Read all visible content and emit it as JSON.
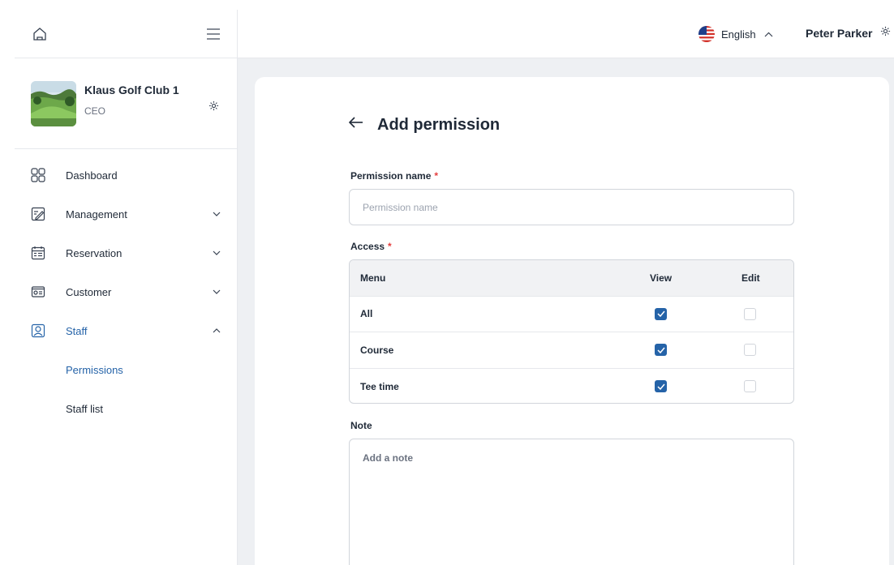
{
  "sidebar": {
    "club": {
      "name": "Klaus Golf Club 1",
      "role": "CEO"
    },
    "items": [
      {
        "label": "Dashboard",
        "icon": "dashboard-grid-icon"
      },
      {
        "label": "Management",
        "icon": "management-edit-icon"
      },
      {
        "label": "Reservation",
        "icon": "calendar-icon"
      },
      {
        "label": "Customer",
        "icon": "id-card-icon"
      },
      {
        "label": "Staff",
        "icon": "user-icon"
      }
    ],
    "staff_sub": [
      {
        "label": "Permissions"
      },
      {
        "label": "Staff list"
      }
    ]
  },
  "header": {
    "language": "English",
    "user_name": "Peter Parker"
  },
  "page": {
    "title": "Add permission",
    "permission_name_label": "Permission name",
    "permission_name_placeholder": "Permission name",
    "permission_name_value": "",
    "access_label": "Access",
    "required_mark": "*",
    "note_label": "Note",
    "note_placeholder": "Add a note"
  },
  "access_table": {
    "headers": {
      "menu": "Menu",
      "view": "View",
      "edit": "Edit"
    },
    "rows": [
      {
        "menu": "All",
        "view": true,
        "edit": false
      },
      {
        "menu": "Course",
        "view": true,
        "edit": false
      },
      {
        "menu": "Tee time",
        "view": true,
        "edit": false
      }
    ]
  },
  "colors": {
    "accent": "#2563a8",
    "required": "#e53e3e",
    "background": "#eef0f3"
  }
}
